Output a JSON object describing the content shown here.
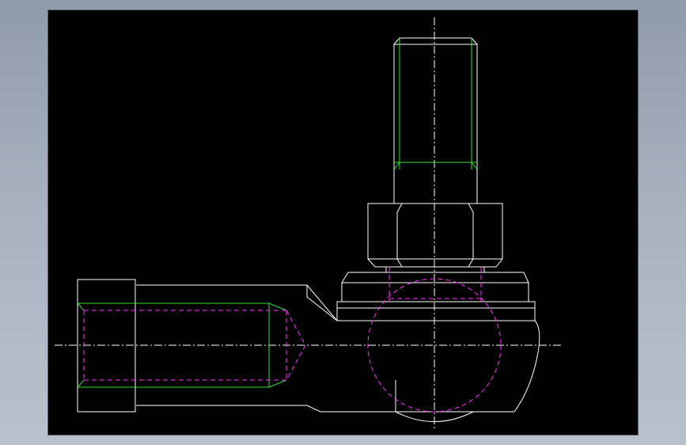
{
  "drawing": {
    "subject": "",
    "colors": {
      "background": "#000000",
      "outline": "#ffffff",
      "thread_line": "#35e035",
      "hidden_line": "#ff33ff",
      "window_bg": "#a7b1be"
    },
    "line_types": [
      "continuous",
      "hidden",
      "center"
    ]
  }
}
